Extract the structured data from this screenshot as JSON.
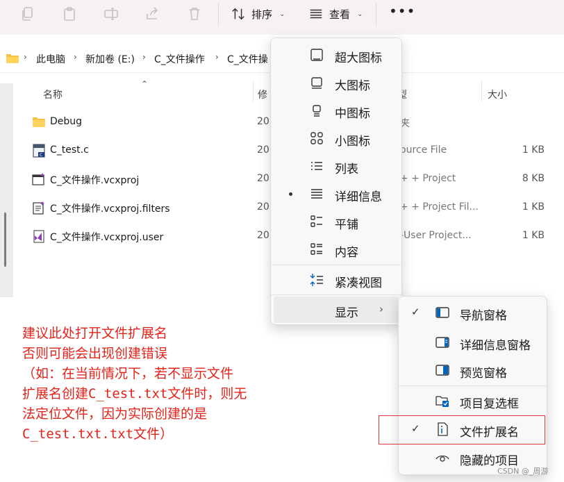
{
  "toolbar": {
    "sort_label": "排序",
    "view_label": "查看",
    "more_label": "•••"
  },
  "breadcrumb": [
    "此电脑",
    "新加卷 (E:)",
    "C_文件操作",
    "C_文件操"
  ],
  "columns": {
    "name": "名称",
    "modified": "修",
    "type": "型",
    "size": "大小"
  },
  "files": [
    {
      "name": "Debug",
      "date": "20",
      "type": "夹",
      "size": "",
      "icon": "folder-icon"
    },
    {
      "name": "C_test.c",
      "date": "20",
      "type": "ource File",
      "size": "1 KB",
      "icon": "c-source-file-icon"
    },
    {
      "name": "C_文件操作.vcxproj",
      "date": "20",
      "type": "+ + Project",
      "size": "8 KB",
      "icon": "vcxproj-file-icon"
    },
    {
      "name": "C_文件操作.vcxproj.filters",
      "date": "20",
      "type": "+ + Project Fil...",
      "size": "1 KB",
      "icon": "filters-file-icon"
    },
    {
      "name": "C_文件操作.vcxproj.user",
      "date": "20",
      "type": "-User Project...",
      "size": "1 KB",
      "icon": "vs-user-file-icon"
    }
  ],
  "view_menu": {
    "items": [
      {
        "label": "超大图标",
        "icon": "extra-large-icons-icon",
        "selected": false
      },
      {
        "label": "大图标",
        "icon": "large-icons-icon",
        "selected": false
      },
      {
        "label": "中图标",
        "icon": "medium-icons-icon",
        "selected": false
      },
      {
        "label": "小图标",
        "icon": "small-icons-icon",
        "selected": false
      },
      {
        "label": "列表",
        "icon": "list-icon",
        "selected": false
      },
      {
        "label": "详细信息",
        "icon": "details-icon",
        "selected": true
      },
      {
        "label": "平铺",
        "icon": "tiles-icon",
        "selected": false
      },
      {
        "label": "内容",
        "icon": "content-icon",
        "selected": false
      }
    ],
    "compact_label": "紧凑视图",
    "show_label": "显示"
  },
  "show_menu": {
    "items": [
      {
        "label": "导航窗格",
        "checked": true,
        "icon": "navigation-pane-icon"
      },
      {
        "label": "详细信息窗格",
        "checked": false,
        "icon": "details-pane-icon"
      },
      {
        "label": "预览窗格",
        "checked": false,
        "icon": "preview-pane-icon"
      },
      {
        "label": "项目复选框",
        "checked": false,
        "icon": "item-checkbox-icon"
      },
      {
        "label": "文件扩展名",
        "checked": true,
        "icon": "file-extension-icon"
      },
      {
        "label": "隐藏的项目",
        "checked": false,
        "icon": "hidden-items-icon"
      }
    ]
  },
  "annotation": {
    "lines": [
      "建议此处打开文件扩展名",
      "否则可能会出现创建错误",
      "（如：在当前情况下，若不显示文件",
      "扩展名创建C_test.txt文件时，则无",
      "法定位文件，因为实际创建的是",
      "C_test.txt.txt文件）"
    ],
    "color": "#e2231a"
  },
  "watermark": "CSDN @_周游",
  "colors": {
    "toolbar_bg": "#f7f1f1",
    "menu_bg": "#f8f8f8",
    "accent": "#0067c0",
    "highlight_border": "#d8363a"
  }
}
